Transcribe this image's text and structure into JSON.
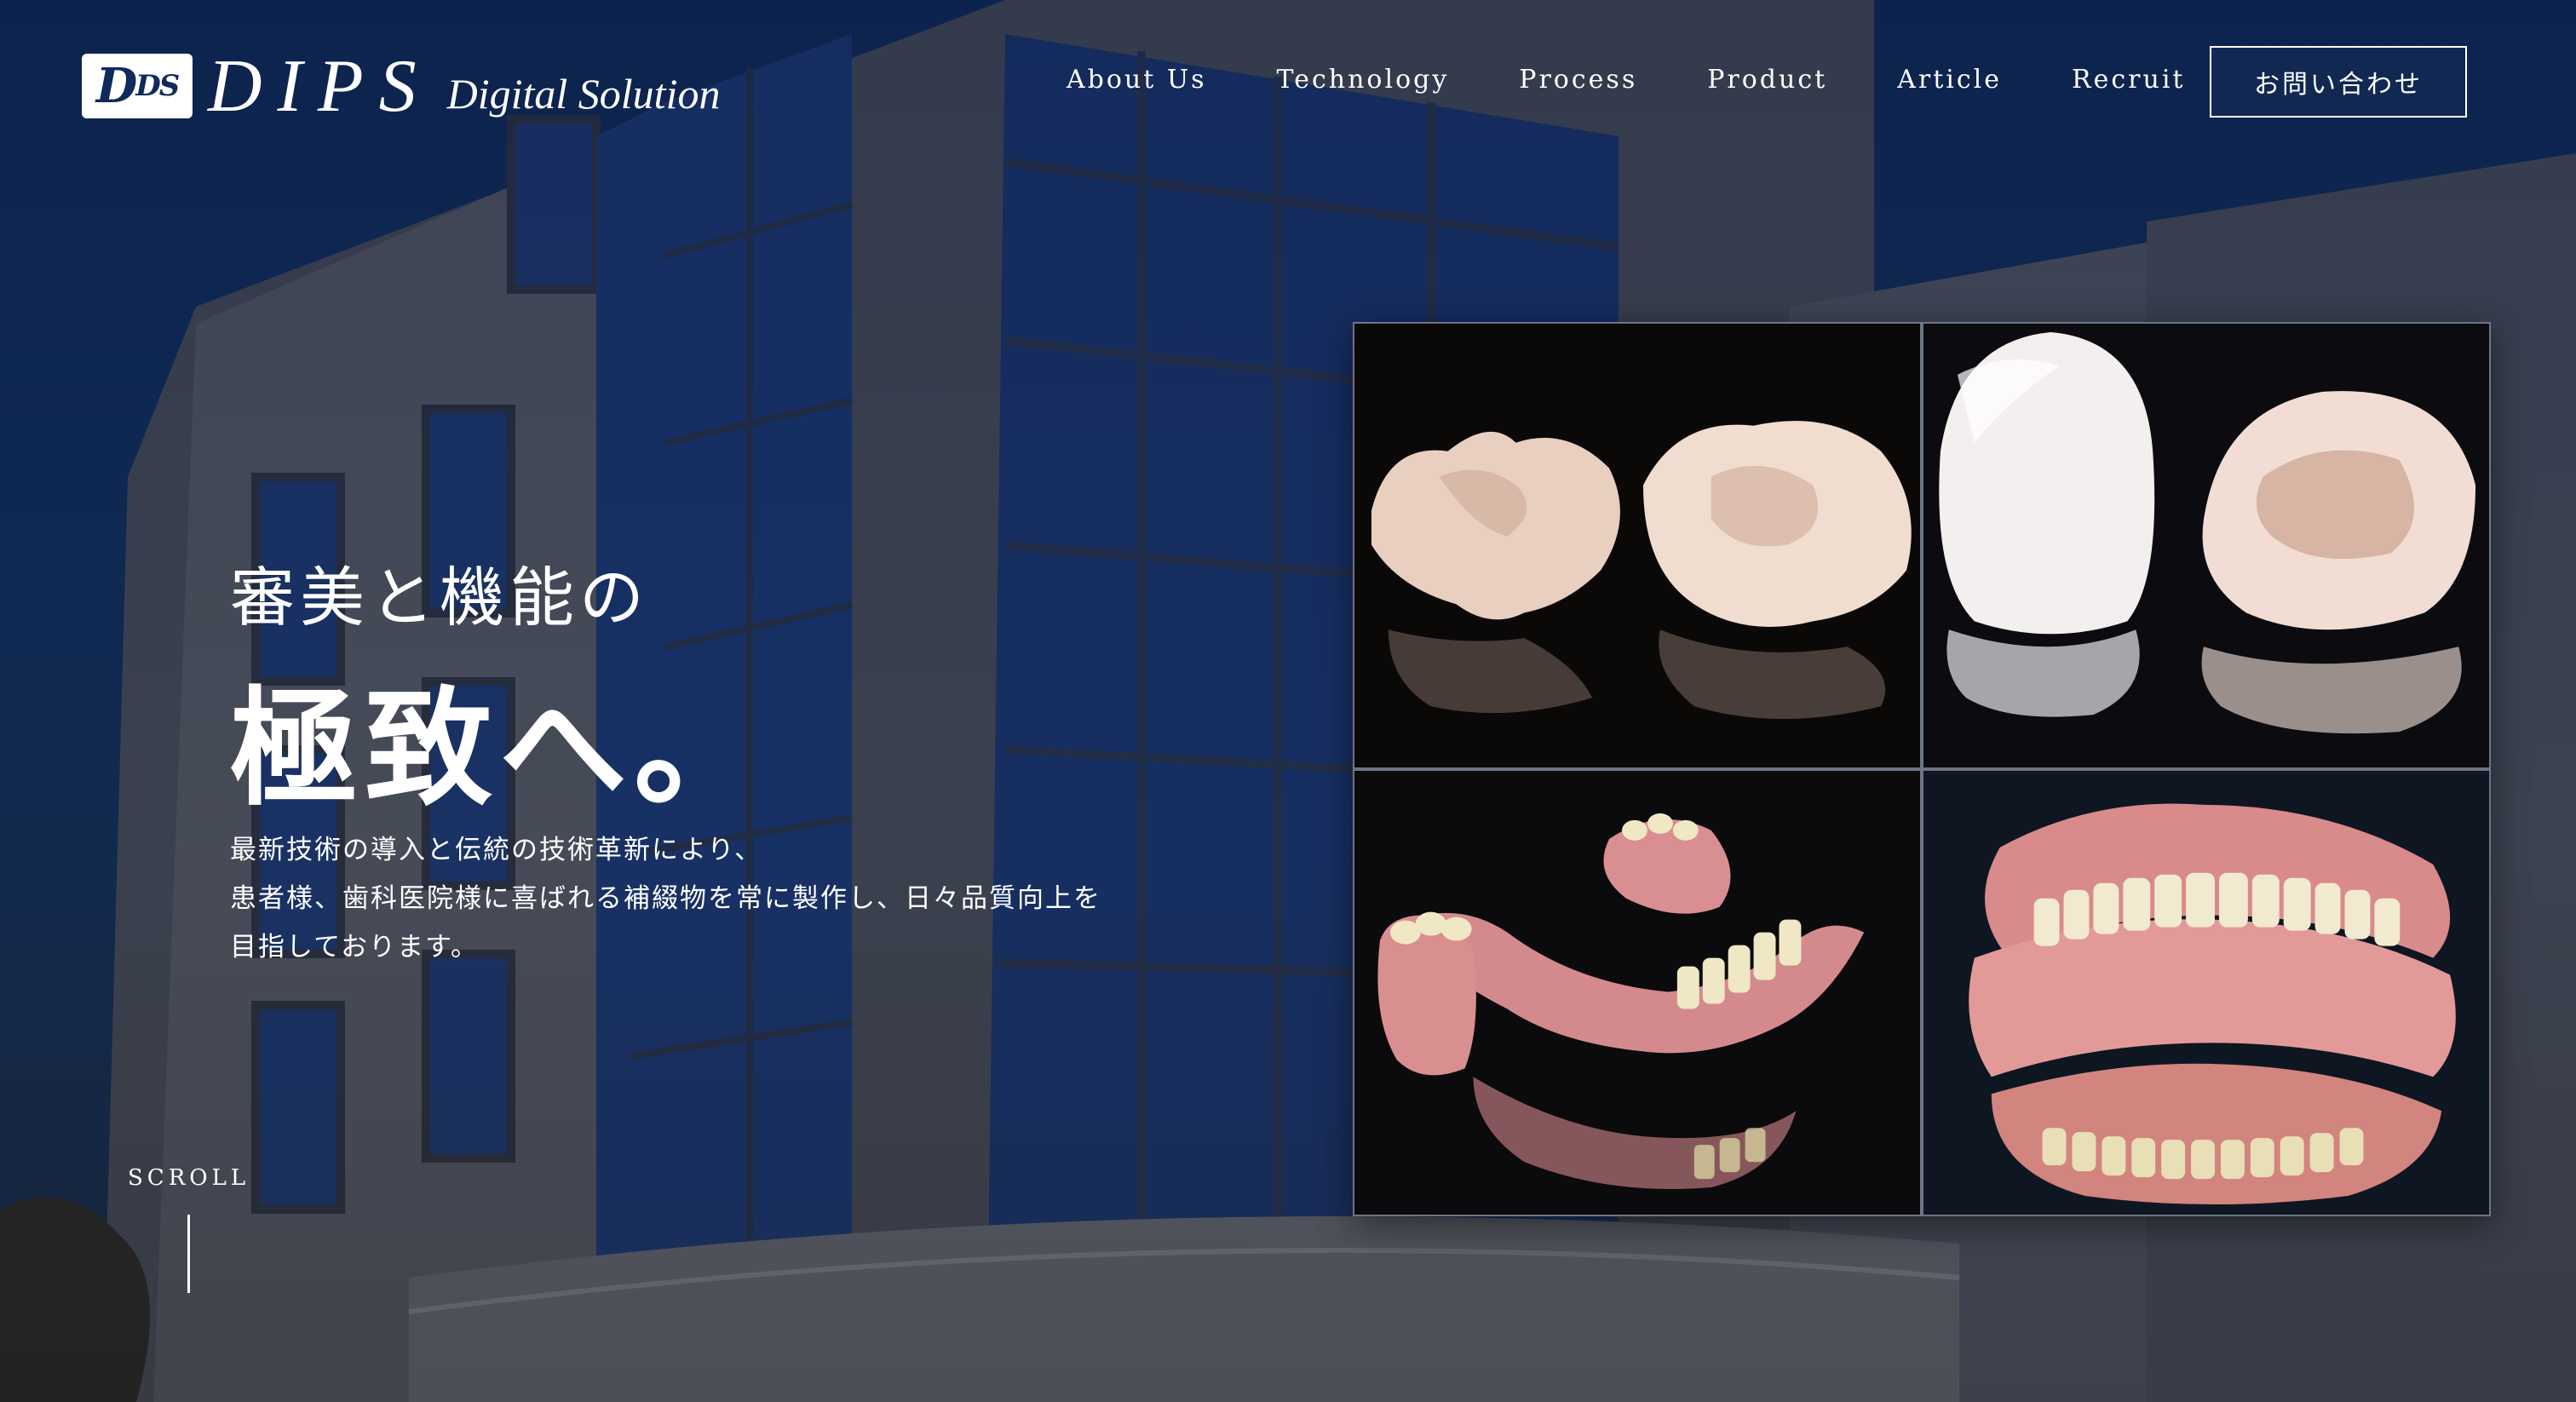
{
  "logo": {
    "mark_main": "D",
    "mark_small": "DS",
    "name": "DIPS",
    "sub": "Digital Solution"
  },
  "nav": {
    "items": [
      "About Us",
      "Technology",
      "Process",
      "Product",
      "Article",
      "Recruit"
    ]
  },
  "contact_button": "お問い合わせ",
  "hero": {
    "tagline_1": "審美と機能の",
    "tagline_2": "極致へ。",
    "description": [
      "最新技術の導入と伝統の技術革新により、",
      "患者様、歯科医院様に喜ばれる補綴物を常に製作し、日々品質向上を",
      "目指しております。"
    ]
  },
  "scroll_label": "SCROLL",
  "colors": {
    "sky": "#0f2a5b",
    "text": "#ffffff",
    "gum": "#d98a8c",
    "tooth": "#f1eacd"
  }
}
